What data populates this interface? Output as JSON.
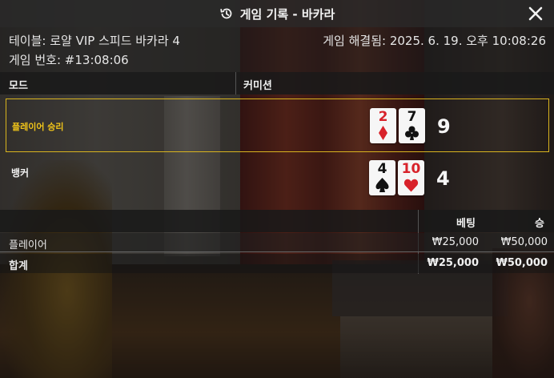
{
  "header": {
    "title": "게임 기록 - 바카라",
    "icon": "history-icon",
    "close_icon": "close-icon"
  },
  "meta": {
    "table": "테이블: 로얄 VIP 스피드 바카라 4",
    "resolved": "게임 해결됨: 2025. 6. 19. 오후 10:08:26",
    "game_number": "게임 번호: #13:08:06"
  },
  "columns": {
    "mode": "모드",
    "commission": "커미션"
  },
  "results": {
    "player": {
      "label": "플레이어 승리",
      "cards": [
        {
          "rank": "2",
          "suit": "diamond",
          "color": "red"
        },
        {
          "rank": "7",
          "suit": "club",
          "color": "black"
        }
      ],
      "score": "9"
    },
    "banker": {
      "label": "뱅커",
      "cards": [
        {
          "rank": "4",
          "suit": "spade",
          "color": "black"
        },
        {
          "rank": "10",
          "suit": "heart",
          "color": "red"
        }
      ],
      "score": "4"
    }
  },
  "bets": {
    "headers": {
      "bet": "베팅",
      "win": "승"
    },
    "rows": [
      {
        "name": "플레이어",
        "bet": "₩25,000",
        "win": "₩50,000"
      }
    ],
    "total": {
      "name": "합계",
      "bet": "₩25,000",
      "win": "₩50,000"
    }
  },
  "colors": {
    "accent": "#d9b41f",
    "red_suit": "#d8222a",
    "black_suit": "#111111"
  }
}
